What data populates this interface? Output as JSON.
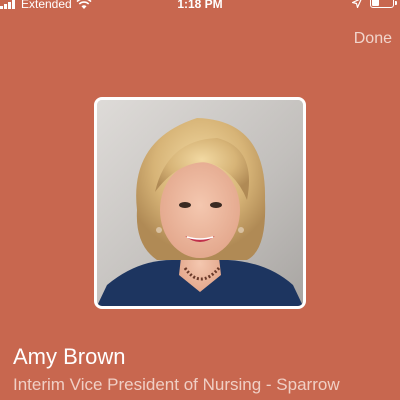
{
  "status_bar": {
    "carrier": "Extended",
    "time": "1:18 PM",
    "battery_level_fraction": 0.3,
    "icons": [
      "signal-icon",
      "wifi-icon",
      "location-arrow-icon",
      "battery-icon"
    ]
  },
  "header": {
    "done_label": "Done"
  },
  "profile": {
    "name": "Amy Brown",
    "title": "Interim Vice President of Nursing - Sparrow"
  },
  "colors": {
    "background": "#c8674f",
    "text_primary": "#ffffff",
    "text_secondary": "#f0cfc5"
  }
}
